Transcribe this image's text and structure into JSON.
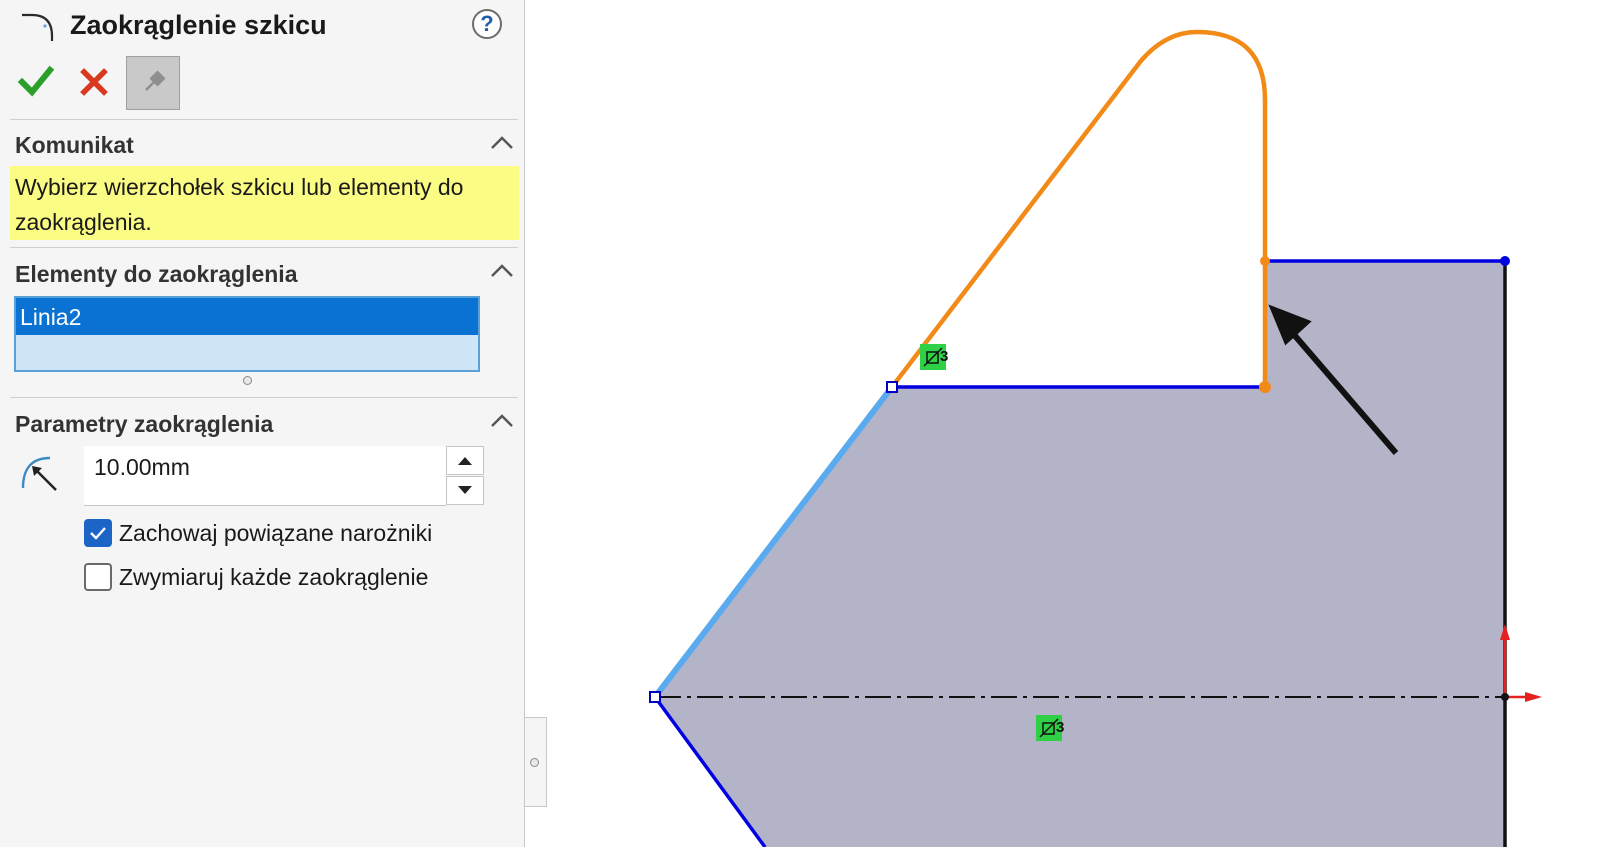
{
  "panel": {
    "title": "Zaokrąglenie szkicu",
    "help_icon": "question-mark-icon",
    "help_label": "?",
    "toolbar": {
      "ok_icon": "checkmark-icon",
      "cancel_icon": "close-icon",
      "pin_icon": "pushpin-icon"
    },
    "message_section": {
      "title": "Komunikat",
      "text": "Wybierz wierzchołek szkicu lub elementy do zaokrąglenia."
    },
    "entities_section": {
      "title": "Elementy do zaokrąglenia",
      "items": [
        "Linia2"
      ]
    },
    "params_section": {
      "title": "Parametry zaokrąglenia",
      "radius_icon": "fillet-radius-icon",
      "radius_value": "10.00mm",
      "keep_constrained_corners": {
        "label": "Zachowaj powiązane narożniki",
        "checked": true
      },
      "dimension_each_fillet": {
        "label": "Zwymiaruj każde zaokrąglenie",
        "checked": false
      }
    }
  },
  "canvas": {
    "relation_badge_icon": "relation-badge-icon",
    "relation_badge_count": "3",
    "colors": {
      "fill": "#b4b4c8",
      "defined_line": "#0000e0",
      "selected_line": "#5aaaf0",
      "preview_line": "#f28a17",
      "badge": "#2fcf46",
      "origin_axis": "#e52020"
    }
  }
}
